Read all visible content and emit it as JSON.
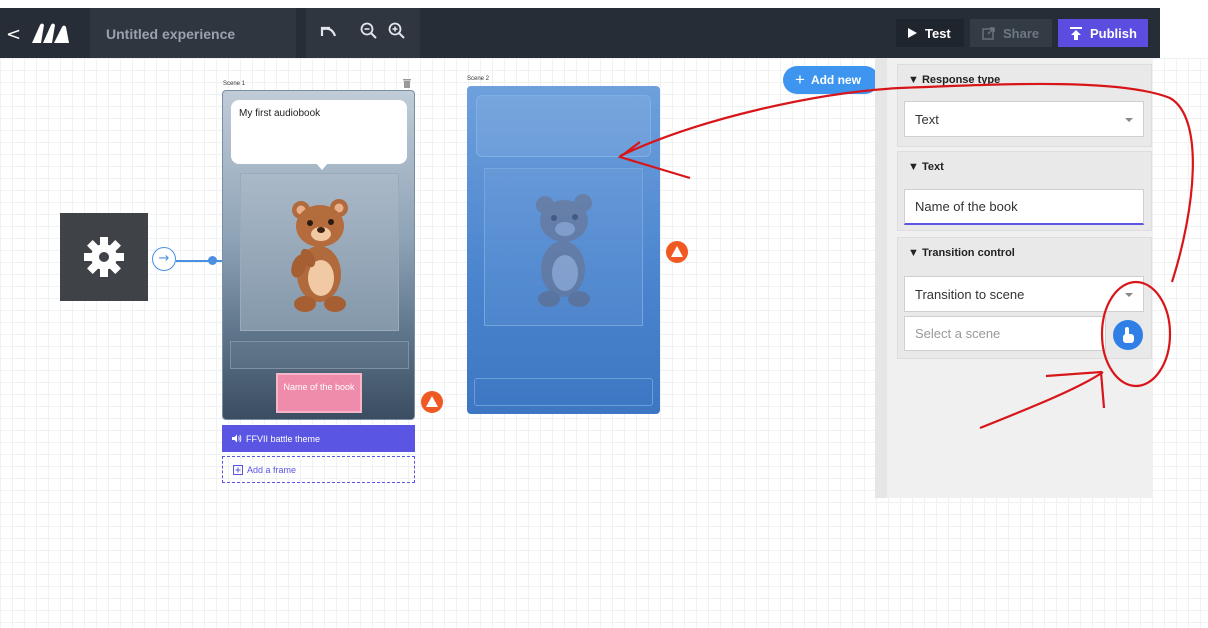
{
  "app": {
    "title": "Untitled experience",
    "back_glyph": "<"
  },
  "toolbar": {
    "undo_icon": "undo-icon",
    "zoom_out_icon": "zoom-out-icon",
    "zoom_in_icon": "zoom-in-icon",
    "test_label": "Test",
    "share_label": "Share",
    "publish_label": "Publish"
  },
  "canvas": {
    "add_new_label": "Add new",
    "scene1": {
      "label": "Scene 1",
      "speech_text": "My first audiobook",
      "button_text": "Name of the book",
      "audio_label": "FFVII battle theme",
      "add_frame_label": "Add a frame"
    },
    "scene2": {
      "label": "Scene 2"
    }
  },
  "panel": {
    "response_type": {
      "heading": "Response type",
      "value": "Text"
    },
    "text": {
      "heading": "Text",
      "value": "Name of the book"
    },
    "transition": {
      "heading": "Transition control",
      "mode_value": "Transition to scene",
      "scene_placeholder": "Select a scene"
    }
  },
  "colors": {
    "topbar": "#272d36",
    "publish": "#5b4de0",
    "accent_blue": "#3d95f0",
    "annotation_red": "#d8161a",
    "warning_orange": "#f05a22"
  }
}
